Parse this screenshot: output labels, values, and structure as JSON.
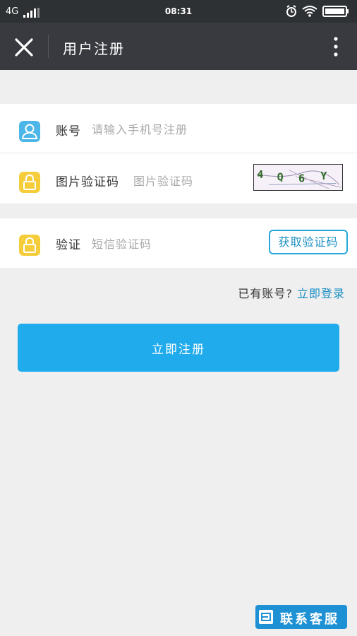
{
  "status": {
    "network": "4G",
    "time": "08:31"
  },
  "header": {
    "title": "用户注册"
  },
  "form": {
    "account": {
      "label": "账号",
      "placeholder": "请输入手机号注册",
      "icon": "user-icon",
      "color": "#4db6e8"
    },
    "captcha": {
      "label": "图片验证码",
      "placeholder": "图片验证码",
      "icon": "lock-icon",
      "color": "#f5cd3b",
      "image_text": [
        "4",
        "Q",
        "6",
        "Y"
      ]
    },
    "sms": {
      "label": "验证",
      "placeholder": "短信验证码",
      "icon": "lock-icon",
      "button_label": "获取验证码"
    }
  },
  "login_prompt": {
    "text": "已有账号?",
    "link": "立即登录"
  },
  "register_button": {
    "label": "立即注册",
    "color": "#20abec"
  },
  "customer_service": {
    "label": "联系客服",
    "icon": "chat-icon"
  }
}
